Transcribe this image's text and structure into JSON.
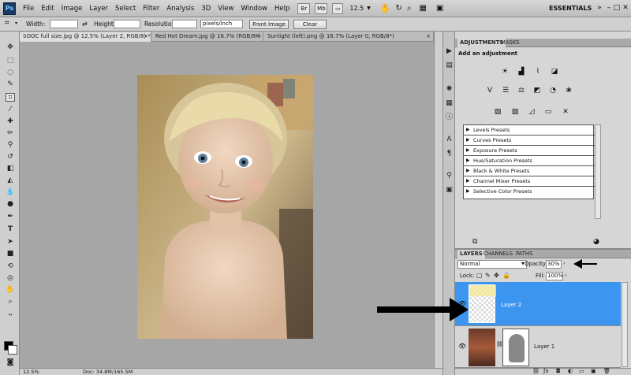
{
  "app": {
    "logo": "Ps"
  },
  "menu": [
    "File",
    "Edit",
    "Image",
    "Layer",
    "Select",
    "Filter",
    "Analysis",
    "3D",
    "View",
    "Window",
    "Help"
  ],
  "menubar": {
    "bridge_btn": "Br",
    "minibridge_btn": "Mb",
    "zoom": "12.5",
    "workspace": "ESSENTIALS",
    "extras": "»",
    "minimize": "–",
    "maximize": "□",
    "close": "✕"
  },
  "options": {
    "width_label": "Width:",
    "height_label": "Height:",
    "resolution_label": "Resolution:",
    "units_value": "pixels/inch",
    "front_image_btn": "Front Image",
    "clear_btn": "Clear"
  },
  "tabs": [
    {
      "label": "SOOC full size.jpg @ 12.5% (Layer 2, RGB/8) *",
      "close": "×"
    },
    {
      "label": "Red Hot Dream.jpg @ 16.7% (RGB/8*)",
      "close": "×"
    },
    {
      "label": "Sunlight (left).png @ 16.7% (Layer 0, RGB/8*)",
      "close": "×"
    }
  ],
  "status": {
    "zoom": "12.5%",
    "doc": "Doc: 34.8M/165.5M"
  },
  "adjustments": {
    "tab_active": "ADJUSTMENTS",
    "tab_other": "MASKS",
    "header": "Add an adjustment",
    "presets": [
      "Levels Presets",
      "Curves Presets",
      "Exposure Presets",
      "Hue/Saturation Presets",
      "Black & White Presets",
      "Channel Mixer Presets",
      "Selective Color Presets"
    ]
  },
  "layers": {
    "tabs": [
      "LAYERS",
      "CHANNELS",
      "PATHS"
    ],
    "blend_mode": "Normal",
    "opacity_label": "Opacity:",
    "opacity_value": "30%",
    "lock_label": "Lock:",
    "fill_label": "Fill:",
    "fill_value": "100%",
    "items": [
      {
        "name": "Layer 2",
        "selected": true
      },
      {
        "name": "Layer 1",
        "selected": false
      }
    ]
  },
  "colors": {
    "selection": "#3c96f0",
    "foreground": "#000000",
    "background": "#ffffff"
  }
}
